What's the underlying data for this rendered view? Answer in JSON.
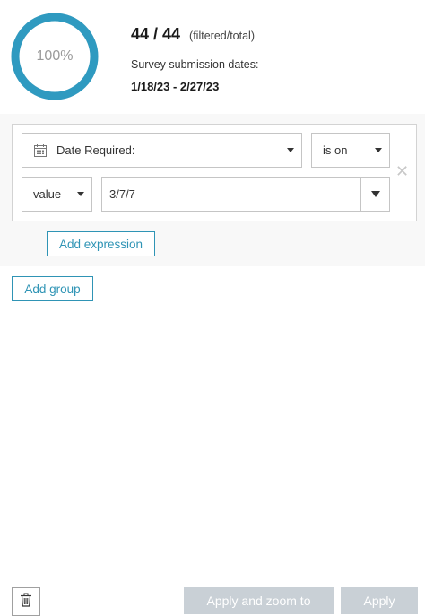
{
  "progress": {
    "percent_label": "100%",
    "fraction": 1.0,
    "color": "#2f9ac0"
  },
  "stats": {
    "count": "44 / 44",
    "count_note": "(filtered/total)",
    "dates_label": "Survey submission dates:",
    "dates_value": "1/18/23 - 2/27/23"
  },
  "expression": {
    "field": "Date Required:",
    "field_icon": "calendar-icon",
    "operator": "is on",
    "value_type": "value",
    "value": "3/7/7",
    "remove_icon": "close-icon"
  },
  "buttons": {
    "add_expression": "Add expression",
    "add_group": "Add group",
    "delete_icon": "trash-icon",
    "apply_zoom": "Apply and zoom to",
    "apply": "Apply"
  },
  "colors": {
    "accent": "#2f94b5",
    "disabled": "#c9d0d6"
  }
}
